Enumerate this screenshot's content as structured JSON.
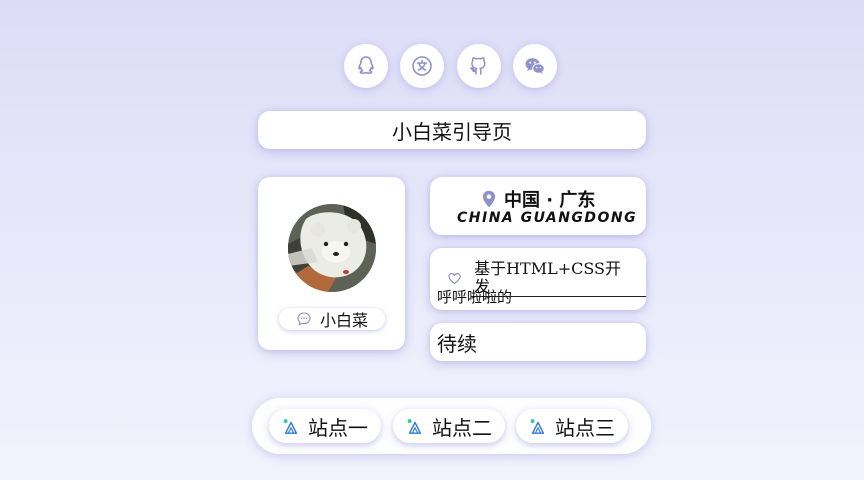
{
  "social": [
    {
      "icon": "qq-icon"
    },
    {
      "icon": "zhihu-icon"
    },
    {
      "icon": "github-icon"
    },
    {
      "icon": "wechat-icon"
    }
  ],
  "title": "小白菜引导页",
  "profile": {
    "avatar": "polar-bear-avatar",
    "name": "小白菜",
    "name_icon": "chat-bubble-icon"
  },
  "location": {
    "icon": "map-pin-icon",
    "cn": "中国 · 广东",
    "en": "CHINA GUANGDONG"
  },
  "description": {
    "icon": "heart-icon",
    "label": "基于HTML+CSS开发",
    "sub": "呼呼啦啦的"
  },
  "todo": "待续",
  "sites": [
    {
      "label": "站点一",
      "icon": "triangle-icon"
    },
    {
      "label": "站点二",
      "icon": "triangle-icon"
    },
    {
      "label": "站点三",
      "icon": "triangle-icon"
    }
  ],
  "colors": {
    "accent": "#8f92c8",
    "background": "#e3e3f9",
    "site_icon_blue": "#2f7bd8",
    "site_icon_teal": "#2ec8b0"
  }
}
